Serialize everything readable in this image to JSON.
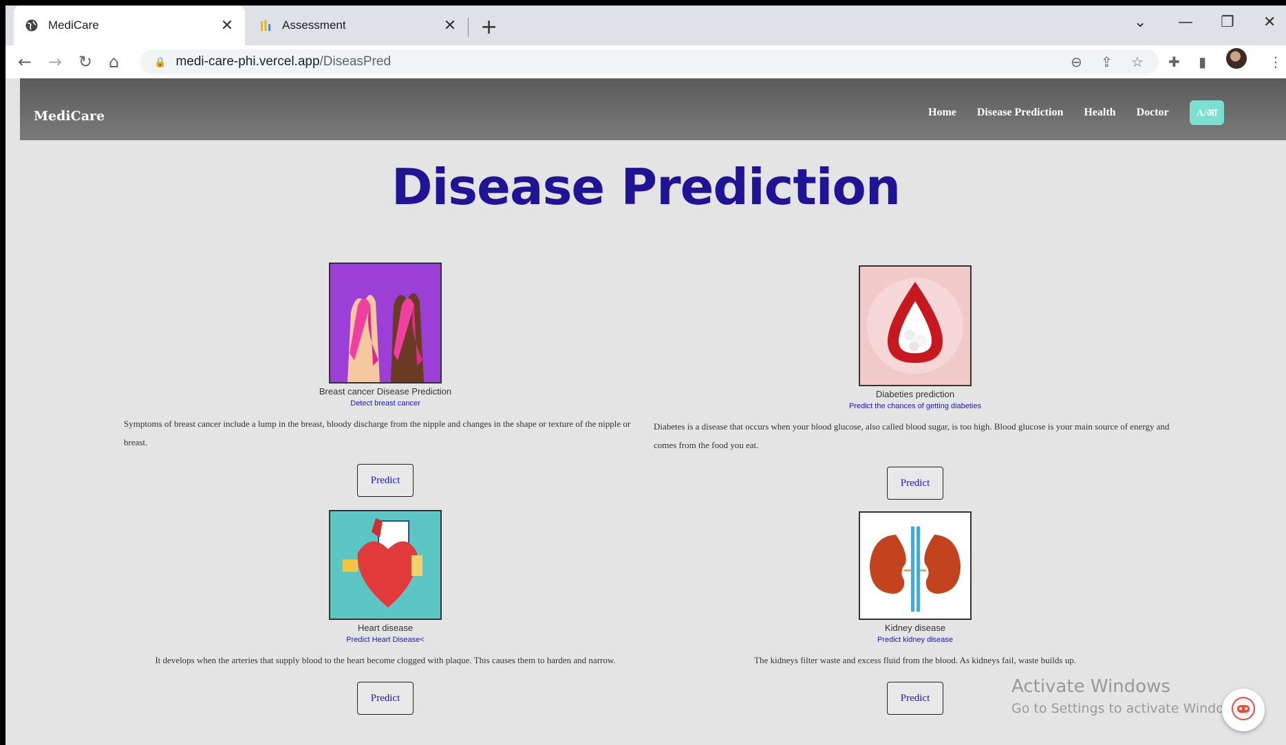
{
  "browser": {
    "tabs": [
      {
        "title": "MediCare",
        "active": true,
        "icon": "globe-icon"
      },
      {
        "title": "Assessment",
        "active": false,
        "icon": "bar-chart-icon"
      }
    ],
    "url_host": "medi-care-phi.vercel.app",
    "url_path": "/DiseasPred"
  },
  "navbar": {
    "brand": "MediCare",
    "links": [
      "Home",
      "Disease Prediction",
      "Health",
      "Doctor"
    ],
    "lang_button": "A/आ",
    "accent": "#79e0d0"
  },
  "title": "Disease Prediction",
  "title_color": "#1f1496",
  "cards": [
    {
      "name": "Breast cancer Disease Prediction",
      "subtitle": "Detect breast cancer",
      "description": "Symptoms of breast cancer include a lump in the breast, bloody discharge from the nipple and changes in the shape or texture of the nipple or breast.",
      "button": "Predict",
      "icon": "pink-ribbon-hands-icon"
    },
    {
      "name": "Diabeties prediction",
      "subtitle": "Predict the chances of getting diabeties",
      "description": "Diabetes is a disease that occurs when your blood glucose, also called blood sugar, is too high. Blood glucose is your main source of energy and comes from the food you eat.",
      "button": "Predict",
      "icon": "blood-sugar-drop-icon"
    },
    {
      "name": "Heart disease",
      "subtitle": "Predict Heart Disease<",
      "description": "It develops when the arteries that supply blood to the heart become clogged with plaque. This causes them to harden and narrow.",
      "button": "Predict",
      "icon": "heart-illustration-icon"
    },
    {
      "name": "Kidney disease",
      "subtitle": "Predict kidney disease",
      "description": "The kidneys filter waste and excess fluid from the blood. As kidneys fail, waste builds up.",
      "button": "Predict",
      "icon": "kidneys-icon"
    }
  ],
  "watermark": {
    "line1": "Activate Windows",
    "line2": "Go to Settings to activate Windows."
  }
}
